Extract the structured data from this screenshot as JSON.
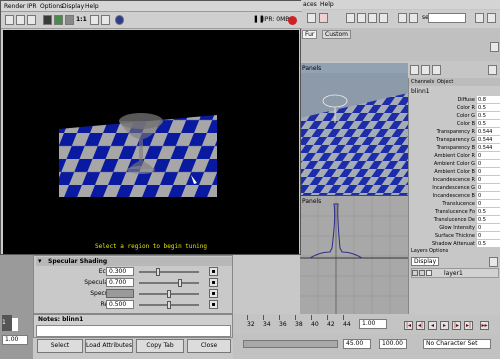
{
  "render_view": {
    "menu": [
      "Render",
      "IPR",
      "Options",
      "Display",
      "Help"
    ],
    "toolbar_ratio": "1:1",
    "ipr_label": "IPR: 0MB",
    "status_message": "Select a region to begin tuning"
  },
  "maya_main": {
    "menu_partial": [
      "aces",
      "Help"
    ],
    "shelf_tabs": [
      "Fur",
      "Custom"
    ],
    "sel_label": "sel",
    "viewport_top_label": "Panels",
    "viewport_bottom_label": "Panels"
  },
  "channel_box": {
    "tabs": [
      "Channels",
      "Object"
    ],
    "object_name": "blinn1",
    "rows": [
      {
        "name": "Diffuse",
        "value": "0.8"
      },
      {
        "name": "Color R",
        "value": "0.5"
      },
      {
        "name": "Color G",
        "value": "0.5"
      },
      {
        "name": "Color B",
        "value": "0.5"
      },
      {
        "name": "Transparency R",
        "value": "0.544"
      },
      {
        "name": "Transparency G",
        "value": "0.544"
      },
      {
        "name": "Transparency B",
        "value": "0.544"
      },
      {
        "name": "Ambient Color R",
        "value": "0"
      },
      {
        "name": "Ambient Color G",
        "value": "0"
      },
      {
        "name": "Ambient Color B",
        "value": "0"
      },
      {
        "name": "Incandescence R",
        "value": "0"
      },
      {
        "name": "Incandescence G",
        "value": "0"
      },
      {
        "name": "Incandescence B",
        "value": "0"
      },
      {
        "name": "Translucence",
        "value": "0"
      },
      {
        "name": "Translucence Fo",
        "value": "0.5"
      },
      {
        "name": "Translucence De",
        "value": "0.5"
      },
      {
        "name": "Glow Intensity",
        "value": "0"
      },
      {
        "name": "Surface Thickne",
        "value": "0"
      },
      {
        "name": "Shadow Attenuat",
        "value": "0.5"
      }
    ]
  },
  "layers": {
    "header": "Layers",
    "options": "Options",
    "dropdown": "Display",
    "layer_name": "layer1"
  },
  "attributes": {
    "section_title": "Specular Shading",
    "rows": [
      {
        "label": "Eccentricity",
        "value": "0.300",
        "level": 0.3
      },
      {
        "label": "Specular Roll Off",
        "value": "0.700",
        "level": 0.7
      },
      {
        "label": "Specular Color",
        "value": "",
        "level": 0.5
      },
      {
        "label": "Reflectivity",
        "value": "0.500",
        "level": 0.5
      }
    ]
  },
  "notes": {
    "label": "Notes: blinn1"
  },
  "buttons": [
    "Select",
    "Load Attributes",
    "Copy Tab",
    "Close"
  ],
  "timeline": {
    "ticks": [
      "32",
      "34",
      "36",
      "38",
      "40",
      "42",
      "44"
    ],
    "current_frame": "1.00",
    "left_frame": "1",
    "start_field": "1.00",
    "range_end": "45.00",
    "range_end2": "100.00",
    "character_set": "No Character Set",
    "frame_field": "1.00"
  },
  "colors": {
    "checker_blue": "#0a1aa0",
    "checker_gray": "#a7a7a7",
    "status_text": "#e6e600",
    "record_red": "#cc2222"
  }
}
